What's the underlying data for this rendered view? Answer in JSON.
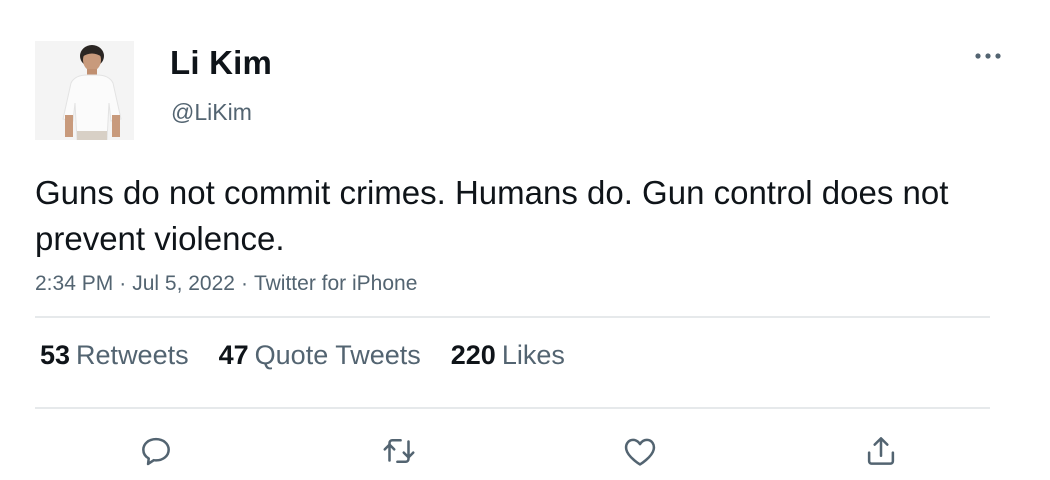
{
  "author": {
    "name": "Li Kim",
    "handle": "@LiKim"
  },
  "tweet": {
    "text": "Guns do not commit crimes. Humans do. Gun control does not prevent violence.",
    "time": "2:34 PM",
    "date": "Jul 5, 2022",
    "source": "Twitter for iPhone",
    "separator": "·"
  },
  "stats": [
    {
      "count": "53",
      "label": "Retweets"
    },
    {
      "count": "47",
      "label": "Quote Tweets"
    },
    {
      "count": "220",
      "label": "Likes"
    }
  ],
  "icons": {
    "more": "more-dots-icon",
    "reply": "reply-icon",
    "retweet": "retweet-icon",
    "like": "heart-icon",
    "share": "share-icon"
  },
  "colors": {
    "text": "#0f1419",
    "secondary": "#536471",
    "divider": "#e6e9eb"
  }
}
